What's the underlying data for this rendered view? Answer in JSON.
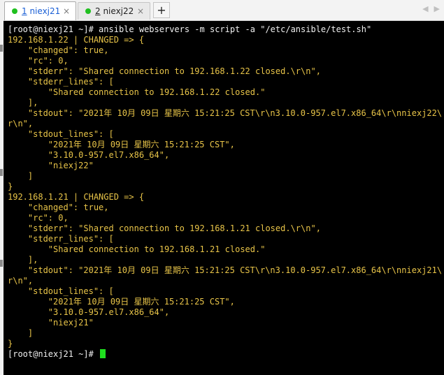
{
  "tabs": [
    {
      "number": "1",
      "name": " niexj21",
      "active": true
    },
    {
      "number": "2",
      "name": " niexj22",
      "active": false
    }
  ],
  "tab_add_label": "+",
  "tab_close_glyph": "×",
  "nav_prev_glyph": "◀",
  "nav_next_glyph": "▶",
  "terminal": {
    "lines": [
      {
        "text": "[root@niexj21 ~]# ansible webservers -m script -a \"/etc/ansible/test.sh\"",
        "kind": "prompt"
      },
      {
        "text": "192.168.1.22 | CHANGED => {",
        "kind": "output"
      },
      {
        "text": "    \"changed\": true,",
        "kind": "output"
      },
      {
        "text": "    \"rc\": 0,",
        "kind": "output"
      },
      {
        "text": "    \"stderr\": \"Shared connection to 192.168.1.22 closed.\\r\\n\",",
        "kind": "output"
      },
      {
        "text": "    \"stderr_lines\": [",
        "kind": "output"
      },
      {
        "text": "        \"Shared connection to 192.168.1.22 closed.\"",
        "kind": "output"
      },
      {
        "text": "    ],",
        "kind": "output"
      },
      {
        "text": "    \"stdout\": \"2021年 10月 09日 星期六 15:21:25 CST\\r\\n3.10.0-957.el7.x86_64\\r\\nniexj22\\",
        "kind": "output"
      },
      {
        "text": "r\\n\",",
        "kind": "output"
      },
      {
        "text": "    \"stdout_lines\": [",
        "kind": "output"
      },
      {
        "text": "        \"2021年 10月 09日 星期六 15:21:25 CST\",",
        "kind": "output"
      },
      {
        "text": "        \"3.10.0-957.el7.x86_64\",",
        "kind": "output"
      },
      {
        "text": "        \"niexj22\"",
        "kind": "output"
      },
      {
        "text": "    ]",
        "kind": "output"
      },
      {
        "text": "}",
        "kind": "output"
      },
      {
        "text": "192.168.1.21 | CHANGED => {",
        "kind": "output"
      },
      {
        "text": "    \"changed\": true,",
        "kind": "output"
      },
      {
        "text": "    \"rc\": 0,",
        "kind": "output"
      },
      {
        "text": "    \"stderr\": \"Shared connection to 192.168.1.21 closed.\\r\\n\",",
        "kind": "output"
      },
      {
        "text": "    \"stderr_lines\": [",
        "kind": "output"
      },
      {
        "text": "        \"Shared connection to 192.168.1.21 closed.\"",
        "kind": "output"
      },
      {
        "text": "    ],",
        "kind": "output"
      },
      {
        "text": "    \"stdout\": \"2021年 10月 09日 星期六 15:21:25 CST\\r\\n3.10.0-957.el7.x86_64\\r\\nniexj21\\",
        "kind": "output"
      },
      {
        "text": "r\\n\",",
        "kind": "output"
      },
      {
        "text": "    \"stdout_lines\": [",
        "kind": "output"
      },
      {
        "text": "        \"2021年 10月 09日 星期六 15:21:25 CST\",",
        "kind": "output"
      },
      {
        "text": "        \"3.10.0-957.el7.x86_64\",",
        "kind": "output"
      },
      {
        "text": "        \"niexj21\"",
        "kind": "output"
      },
      {
        "text": "    ]",
        "kind": "output"
      },
      {
        "text": "}",
        "kind": "output"
      }
    ],
    "final_prompt": "[root@niexj21 ~]# "
  },
  "colors": {
    "terminal_bg": "#000000",
    "output_text": "#e8c448",
    "prompt_text": "#f0f0f0",
    "cursor": "#1fe01f",
    "tab_dot": "#20c020",
    "active_tab_text": "#1a5fd6"
  }
}
